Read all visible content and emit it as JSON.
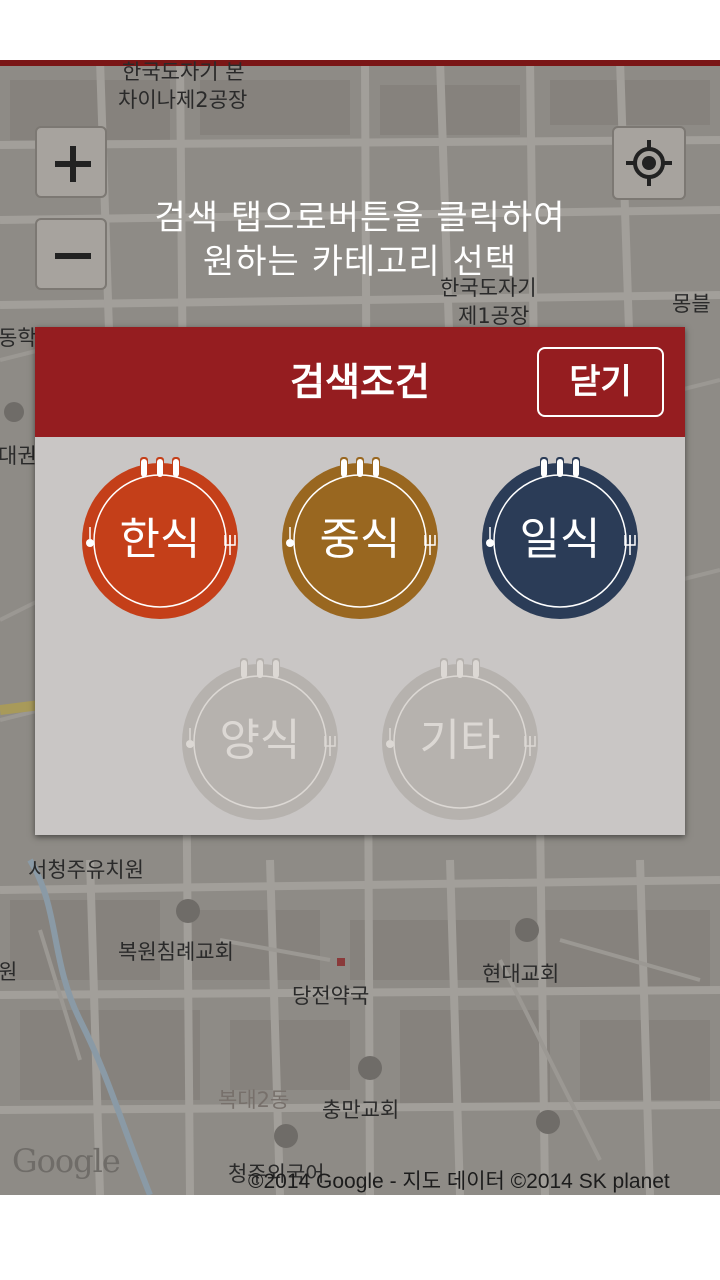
{
  "map": {
    "labels": [
      "한국도자기 본",
      "차이나제2공장",
      "한국도자기",
      "제1공장",
      "몽블",
      "동학",
      "대권",
      "서청주유치원",
      "복원침례교회",
      "현대교회",
      "당전약국",
      "복대2동",
      "충만교회",
      "청주외국어",
      "원"
    ],
    "google_logo": "Google",
    "attribution": "©2014 Google - 지도 데이터 ©2014 SK planet"
  },
  "controls": {
    "zoom_in_icon": "plus-icon",
    "zoom_out_icon": "minus-icon",
    "locate_icon": "crosshair-icon"
  },
  "instruction": {
    "line1": "검색 탭으로버튼을 클릭하여",
    "line2": "원하는 카테고리 선택"
  },
  "dialog": {
    "title": "검색조건",
    "close_label": "닫기",
    "categories": [
      {
        "label": "한식",
        "color": "#c43f19",
        "enabled": true
      },
      {
        "label": "중식",
        "color": "#996720",
        "enabled": true
      },
      {
        "label": "일식",
        "color": "#2b3c57",
        "enabled": true
      },
      {
        "label": "양식",
        "color": "#b6b2ae",
        "enabled": false
      },
      {
        "label": "기타",
        "color": "#b6b2ae",
        "enabled": false
      }
    ]
  },
  "colors": {
    "header": "#951d20",
    "dialog_body": "#c9c6c5",
    "map_overlay": "#8e8b86"
  }
}
